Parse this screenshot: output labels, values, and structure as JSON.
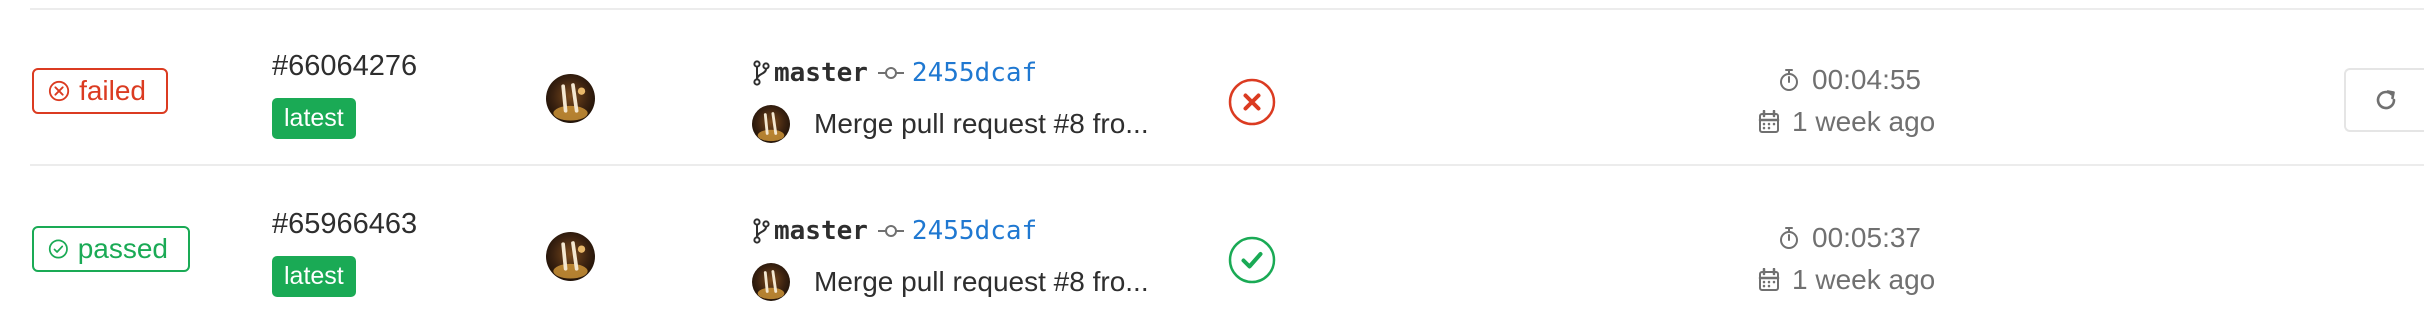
{
  "pipelines": [
    {
      "status": "failed",
      "pipeline_id": "#66064276",
      "tag": "latest",
      "branch": "master",
      "commit_sha": "2455dcaf",
      "commit_message": "Merge pull request #8 fro...",
      "stage_status": "failed",
      "duration": "00:04:55",
      "finished": "1 week ago",
      "has_retry": true
    },
    {
      "status": "passed",
      "pipeline_id": "#65966463",
      "tag": "latest",
      "branch": "master",
      "commit_sha": "2455dcaf",
      "commit_message": "Merge pull request #8 fro...",
      "stage_status": "passed",
      "duration": "00:05:37",
      "finished": "1 week ago",
      "has_retry": false
    }
  ],
  "icons": {
    "status_failed": "circle-x-icon",
    "status_passed": "circle-check-icon",
    "branch": "git-branch-icon",
    "commit": "git-commit-icon",
    "duration": "stopwatch-icon",
    "finished": "calendar-icon",
    "retry": "retry-icon"
  },
  "colors": {
    "failed": "#db3b21",
    "passed": "#1aaa55",
    "link": "#1f78d1",
    "muted": "#707070"
  }
}
